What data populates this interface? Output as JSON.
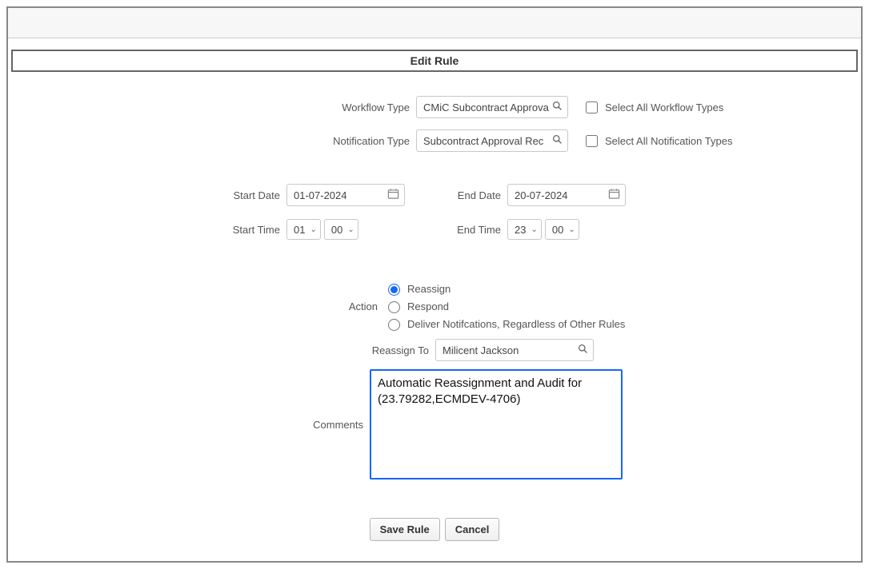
{
  "title": "Edit Rule",
  "workflow_type": {
    "label": "Workflow Type",
    "value": "CMiC Subcontract Approva",
    "select_all_label": "Select All Workflow Types"
  },
  "notification_type": {
    "label": "Notification Type",
    "value": "Subcontract  Approval Rec",
    "select_all_label": "Select All Notification Types"
  },
  "start_date": {
    "label": "Start Date",
    "value": "01-07-2024"
  },
  "end_date": {
    "label": "End Date",
    "value": "20-07-2024"
  },
  "start_time": {
    "label": "Start Time",
    "hour": "01",
    "minute": "00"
  },
  "end_time": {
    "label": "End Time",
    "hour": "23",
    "minute": "00"
  },
  "action": {
    "label": "Action",
    "options": {
      "reassign": "Reassign",
      "respond": "Respond",
      "deliver": "Deliver Notifcations, Regardless of Other Rules"
    },
    "selected": "reassign"
  },
  "reassign_to": {
    "label": "Reassign To",
    "value": "Milicent Jackson"
  },
  "comments": {
    "label": "Comments",
    "value": "Automatic Reassignment and Audit for (23.79282,ECMDEV-4706)"
  },
  "buttons": {
    "save": "Save Rule",
    "cancel": "Cancel"
  }
}
